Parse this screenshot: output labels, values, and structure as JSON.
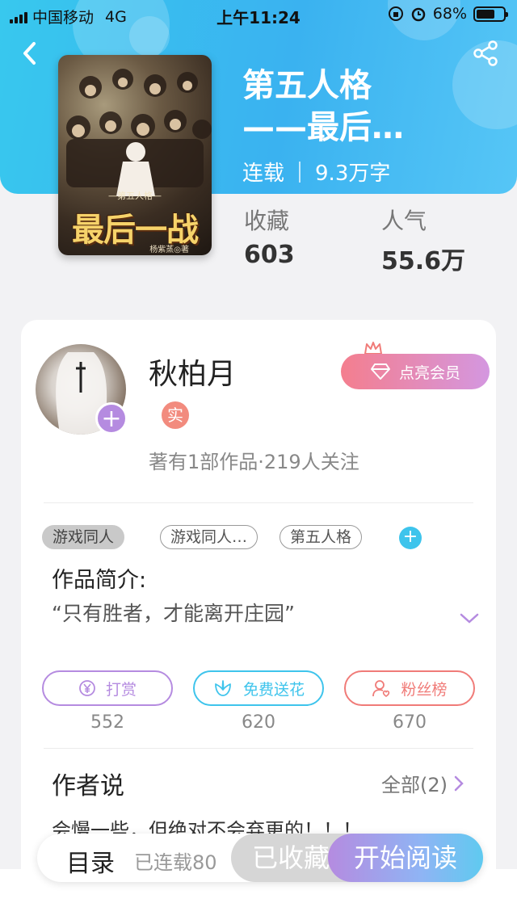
{
  "status_bar": {
    "carrier": "中国移动",
    "network": "4G",
    "time": "上午11:24",
    "battery": "68%",
    "battery_level": 0.68
  },
  "book": {
    "title": "第五人格——最后…",
    "title_line1": "第五人格",
    "title_line2": "——最后…",
    "status": "连载",
    "word_count": "9.3万字",
    "cover": {
      "subtitle": "—第五人格—",
      "title": "最后一战",
      "author": "杨紫蒸◎著"
    },
    "favorites_label": "收藏",
    "favorites_value": "603",
    "popularity_label": "人气",
    "popularity_value": "55.6万"
  },
  "author": {
    "name": "秋柏月",
    "real_badge": "实",
    "summary": "著有1部作品·219人关注",
    "vip_button": "点亮会员"
  },
  "tags": [
    "游戏同人",
    "游戏同人…",
    "第五人格"
  ],
  "intro": {
    "title": "作品简介:",
    "text": "“只有胜者，才能离开庄园”"
  },
  "actions": [
    {
      "label": "打赏",
      "count": "552",
      "color": "#b58be0",
      "icon": "yen-icon"
    },
    {
      "label": "免费送花",
      "count": "620",
      "color": "#3ec4ec",
      "icon": "flower-icon"
    },
    {
      "label": "粉丝榜",
      "count": "670",
      "color": "#f07b78",
      "icon": "fan-icon"
    }
  ],
  "author_says": {
    "title": "作者说",
    "all_link": "全部(2)",
    "text": "会慢一些，但绝对不会弃更的！！！"
  },
  "bottom_bar": {
    "toc": "目录",
    "toc_sub": "已连载80",
    "collected": "已收藏",
    "start_reading": "开始阅读"
  },
  "colors": {
    "header_gradient": [
      "#38c8ee",
      "#56c6f6"
    ],
    "accent_purple": "#b58be0",
    "accent_blue": "#3ec4ec",
    "accent_red": "#f07b78"
  }
}
